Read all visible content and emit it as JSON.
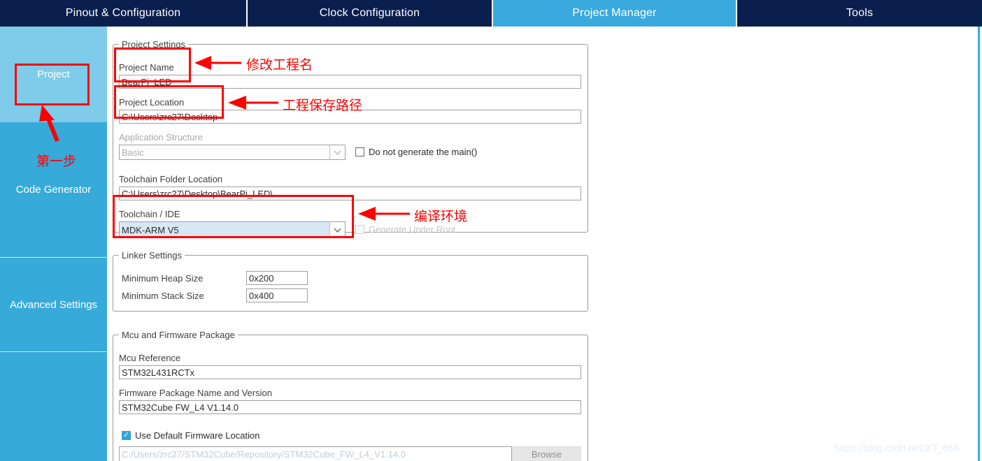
{
  "tabs": [
    {
      "label": "Pinout & Configuration",
      "active": false
    },
    {
      "label": "Clock Configuration",
      "active": false
    },
    {
      "label": "Project Manager",
      "active": true
    },
    {
      "label": "Tools",
      "active": false
    }
  ],
  "sidebar": {
    "items": [
      {
        "label": "Project",
        "active": true
      },
      {
        "label": "Code Generator",
        "active": false
      },
      {
        "label": "Advanced Settings",
        "active": false
      },
      {
        "label": "",
        "active": false
      }
    ]
  },
  "project_settings": {
    "legend": "Project Settings",
    "project_name_label": "Project Name",
    "project_name_value": "BearPi_LED",
    "project_location_label": "Project Location",
    "project_location_value": "C:\\Users\\zrc27\\Desktop",
    "application_structure_label": "Application Structure",
    "application_structure_value": "Basic",
    "do_not_generate_main_label": "Do not generate the main()",
    "do_not_generate_main_checked": false,
    "toolchain_folder_label": "Toolchain Folder Location",
    "toolchain_folder_value": "C:\\Users\\zrc27\\Desktop\\BearPi_LED\\",
    "toolchain_ide_label": "Toolchain / IDE",
    "toolchain_ide_value": "MDK-ARM V5",
    "generate_under_root_label": "Generate Under Root",
    "generate_under_root_checked": false
  },
  "linker_settings": {
    "legend": "Linker Settings",
    "min_heap_label": "Minimum Heap Size",
    "min_heap_value": "0x200",
    "min_stack_label": "Minimum Stack Size",
    "min_stack_value": "0x400"
  },
  "mcu_firmware": {
    "legend": "Mcu and Firmware Package",
    "mcu_reference_label": "Mcu Reference",
    "mcu_reference_value": "STM32L431RCTx",
    "firmware_package_label": "Firmware Package Name and Version",
    "firmware_package_value": "STM32Cube FW_L4 V1.14.0",
    "use_default_location_label": "Use Default Firmware Location",
    "use_default_location_checked": true,
    "firmware_path_value": "C:/Users/zrc27/STM32Cube/Repository/STM32Cube_FW_L4_V1.14.0",
    "browse_label": "Browse"
  },
  "annotations": {
    "color": "#ff0000",
    "step_one": "第一步",
    "modify_project_name": "修改工程名",
    "project_save_path": "工程保存路径",
    "compile_environment": "编译环境"
  },
  "watermark": {
    "text": "https://blog.csdn.net/XT_666"
  },
  "colors": {
    "tab_inactive_bg": "#0a1f4e",
    "tab_active_bg": "#3aa9dd",
    "sidebar_bg": "#36aad9",
    "sidebar_active_bg": "#7ecbea",
    "annotation_red": "#ff0000",
    "combo_selected_bg": "#d7e7f3"
  }
}
